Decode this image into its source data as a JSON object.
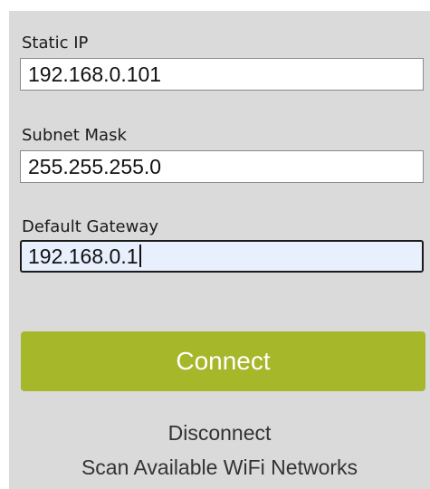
{
  "form": {
    "static_ip": {
      "label": "Static IP",
      "value": "192.168.0.101"
    },
    "subnet_mask": {
      "label": "Subnet Mask",
      "value": "255.255.255.0"
    },
    "default_gateway": {
      "label": "Default Gateway",
      "value": "192.168.0.1"
    }
  },
  "actions": {
    "connect_label": "Connect",
    "disconnect_label": "Disconnect",
    "scan_label": "Scan Available WiFi Networks"
  },
  "colors": {
    "panel_background": "#dadada",
    "connect_button": "#a6b729",
    "focused_input_background": "#e8f0fe"
  }
}
